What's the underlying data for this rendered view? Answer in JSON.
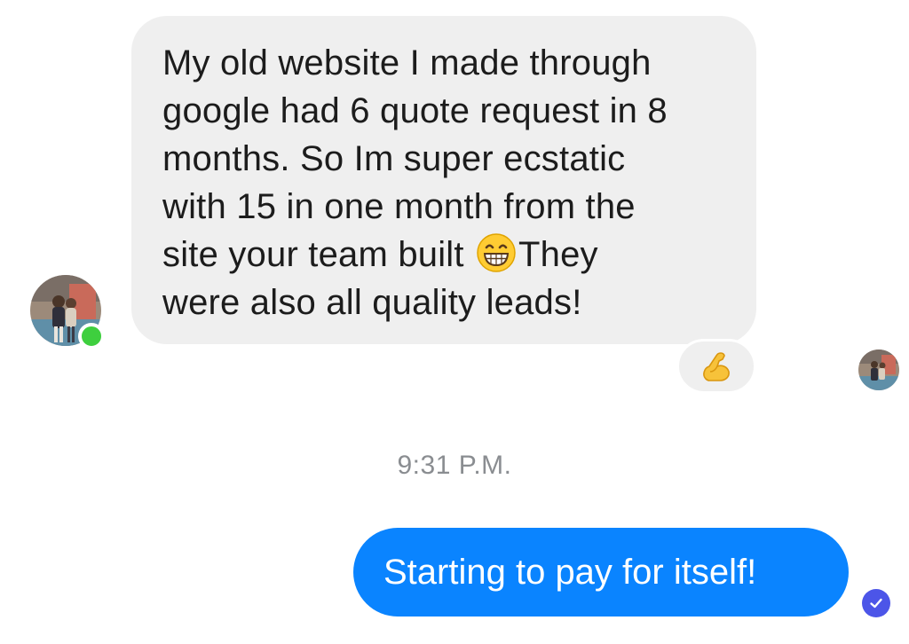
{
  "conversation": {
    "incoming_message": {
      "lines": [
        "My old website I made through",
        "google had 6 quote request in 8",
        "months. So Im super ecstatic",
        "with 15 in one month from the",
        "site your team built",
        "They",
        "were also all quality leads!"
      ],
      "inline_emoji": "grinning-face-with-smiling-eyes",
      "reaction_emoji": "flexed-biceps"
    },
    "timestamp": "9:31 P.M.",
    "outgoing_message": {
      "text": "Starting to pay for itself!",
      "status_icon": "seen-check-icon"
    },
    "colors": {
      "incoming_bubble": "#efefef",
      "outgoing_bubble": "#0a84ff",
      "online_indicator": "#3ecf3e",
      "seen_indicator": "#4c55e8",
      "timestamp_text": "#8a8d91"
    }
  }
}
